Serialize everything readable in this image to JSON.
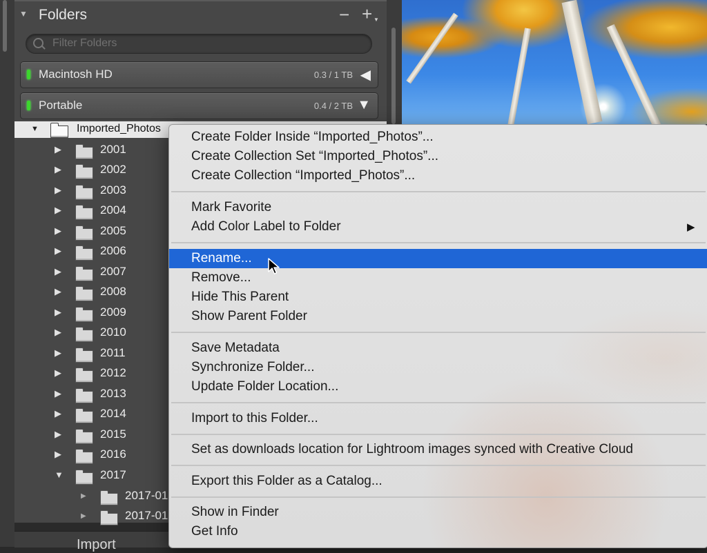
{
  "panel": {
    "title": "Folders",
    "minus_label": "−",
    "plus_label": "+",
    "filter_placeholder": "Filter Folders",
    "volumes": [
      {
        "name": "Macintosh HD",
        "size": "0.3 / 1 TB",
        "arrow": "◀"
      },
      {
        "name": "Portable",
        "size": "0.4 / 2 TB",
        "arrow": "▼"
      }
    ],
    "root_folder": "Imported_Photos",
    "year_folders": [
      "2001",
      "2002",
      "2003",
      "2004",
      "2005",
      "2006",
      "2007",
      "2008",
      "2009",
      "2010",
      "2011",
      "2012",
      "2013",
      "2014",
      "2015",
      "2016",
      "2017"
    ],
    "sub_folders": [
      "2017-01-",
      "2017-01-"
    ],
    "bottom_panel_label": "Import"
  },
  "context_menu": {
    "groups": [
      [
        "Create Folder Inside “Imported_Photos”...",
        "Create Collection Set “Imported_Photos”...",
        "Create Collection “Imported_Photos”..."
      ],
      [
        "Mark Favorite",
        "Add Color Label to Folder"
      ],
      [
        "Rename...",
        "Remove...",
        "Hide This Parent",
        "Show Parent Folder"
      ],
      [
        "Save Metadata",
        "Synchronize Folder...",
        "Update Folder Location..."
      ],
      [
        "Import to this Folder..."
      ],
      [
        "Set as downloads location for Lightroom images synced with Creative Cloud"
      ],
      [
        "Export this Folder as a Catalog..."
      ],
      [
        "Show in Finder",
        "Get Info"
      ]
    ],
    "highlighted": "Rename...",
    "submenu_arrow": "▶"
  },
  "colors": {
    "highlight": "#1f66d6",
    "volume_led": "#3cd62d",
    "panel_bg": "#474747"
  }
}
